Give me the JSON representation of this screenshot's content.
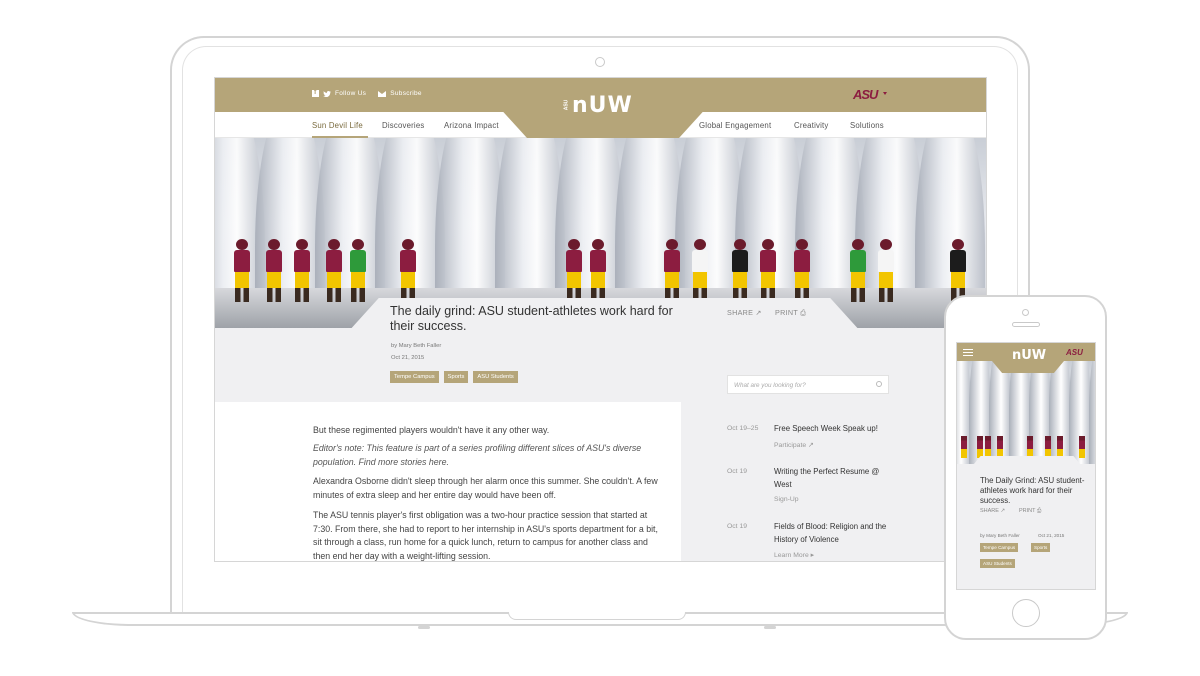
{
  "topbar": {
    "follow": "Follow Us",
    "subscribe": "Subscribe",
    "logo": "ASU"
  },
  "brand": {
    "small": "ASU",
    "name": "nUW"
  },
  "nav": {
    "left": [
      "Sun Devil Life",
      "Discoveries",
      "Arizona Impact"
    ],
    "right": [
      "Global Engagement",
      "Creativity",
      "Solutions"
    ],
    "active": "Sun Devil Life"
  },
  "article": {
    "title": "The daily grind: ASU student-athletes work hard for their success.",
    "share": "SHARE ↗",
    "print": "PRINT ⎙",
    "byline": "by Mary Beth Faller",
    "date": "Oct 21, 2015",
    "tags": [
      "Tempe Campus",
      "Sports",
      "ASU Students"
    ],
    "paragraphs": [
      "But these regimented players wouldn't have it any other way.",
      "Editor's note: This feature is part of a series profiling different slices of ASU's diverse population. Find more stories here.",
      "Alexandra Osborne didn't sleep through her alarm once this summer. She couldn't. A few minutes of extra sleep and her entire day would have been off.",
      "The ASU tennis player's first obligation was a two-hour practice session that started at 7:30. From there, she had to report to her internship in ASU's sports department for a bit, sit through a class, run home for a quick lunch, return to campus for another class and then end her day with a weight-lifting session."
    ]
  },
  "search": {
    "placeholder": "What are you looking for?"
  },
  "events": [
    {
      "date": "Oct 19–25",
      "title": "Free Speech Week Speak up!",
      "link": "Participate ↗"
    },
    {
      "date": "Oct 19",
      "title": "Writing the Perfect Resume @ West",
      "link": "Sign-Up"
    },
    {
      "date": "Oct 19",
      "title": "Fields of Blood: Religion and the History of Violence",
      "link": "Learn More ▸"
    }
  ],
  "mobile": {
    "title": "The Daily Grind: ASU student-athletes work hard for their success.",
    "share": "SHARE ↗",
    "print": "PRINT ⎙",
    "byline": "by Mary Beth Faller",
    "date": "Oct 21, 2015",
    "tags": [
      "Tempe Campus",
      "Sports",
      "ASU Students"
    ]
  },
  "colors": {
    "gold": "#b5a579",
    "maroon": "#8c1d40",
    "yellow": "#f2c500"
  }
}
